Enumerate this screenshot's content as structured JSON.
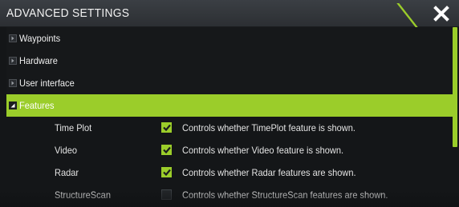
{
  "header": {
    "title": "ADVANCED SETTINGS",
    "close_icon": "close-icon"
  },
  "tree": [
    {
      "label": "Waypoints",
      "expanded": false
    },
    {
      "label": "Hardware",
      "expanded": false
    },
    {
      "label": "User interface",
      "expanded": false
    },
    {
      "label": "Features",
      "expanded": true,
      "selected": true
    }
  ],
  "features": [
    {
      "name": "Time Plot",
      "checked": true,
      "description": "Controls whether TimePlot feature is shown."
    },
    {
      "name": "Video",
      "checked": true,
      "description": "Controls whether Video feature is shown."
    },
    {
      "name": "Radar",
      "checked": true,
      "description": "Controls whether Radar features are shown."
    },
    {
      "name": "StructureScan",
      "checked": false,
      "description": "Controls whether StructureScan features are shown."
    }
  ],
  "colors": {
    "accent": "#9bcd2a",
    "background": "#141618",
    "titlebar": "#34383c"
  }
}
